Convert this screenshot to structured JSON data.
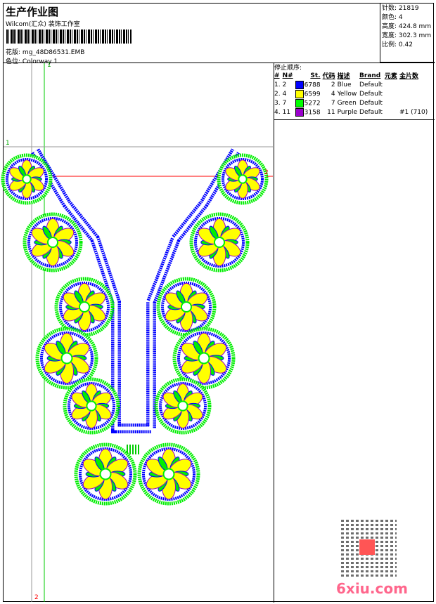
{
  "header": {
    "title": "生产作业图",
    "company": "Wilcom(汇众) 装饰工作室",
    "design_label": "花版:",
    "design_value": "mg_48D86531.EMB",
    "colorway_label": "色位:",
    "colorway_value": "Colorway 1"
  },
  "stats": [
    {
      "label": "针数:",
      "value": "21819"
    },
    {
      "label": "颜色:",
      "value": "4"
    },
    {
      "label": "高度:",
      "value": "424.8 mm"
    },
    {
      "label": "宽度:",
      "value": "302.3 mm"
    },
    {
      "label": "比例:",
      "value": "0.42"
    }
  ],
  "stop_sequence": {
    "label": "停止顺序:",
    "columns": [
      "#",
      "N#",
      "St.",
      "代码",
      "描述",
      "Brand",
      "元素",
      "金片数"
    ],
    "rows": [
      {
        "idx": "1.",
        "n": "2",
        "color": "#0000ff",
        "st": "6788",
        "code": "2",
        "desc": "Blue",
        "brand": "Default",
        "extra": ""
      },
      {
        "idx": "2.",
        "n": "4",
        "color": "#ffff00",
        "st": "6599",
        "code": "4",
        "desc": "Yellow",
        "brand": "Default",
        "extra": ""
      },
      {
        "idx": "3.",
        "n": "7",
        "color": "#00ff00",
        "st": "5272",
        "code": "7",
        "desc": "Green",
        "brand": "Default",
        "extra": ""
      },
      {
        "idx": "4.",
        "n": "11",
        "color": "#9900cc",
        "st": "3158",
        "code": "11",
        "desc": "Purple",
        "brand": "Default",
        "extra": "#1 (710)"
      }
    ]
  },
  "guides": {
    "v1": "1",
    "h1": "1",
    "h2": "2",
    "v2": "2"
  },
  "watermark": "6xiu.com"
}
